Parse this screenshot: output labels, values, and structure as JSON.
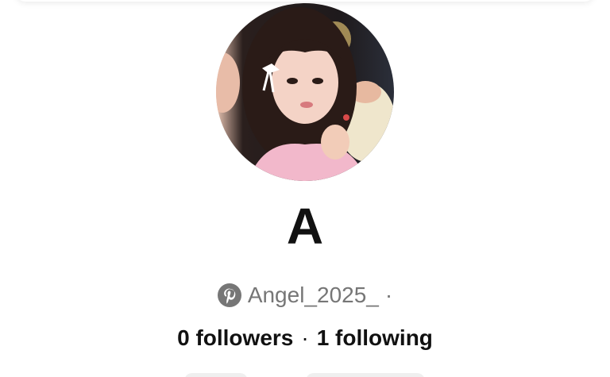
{
  "profile": {
    "display_name": "A",
    "username": "Angel_2025_",
    "username_suffix": "·",
    "followers_count": "0 followers",
    "separator": "·",
    "following_count": "1 following",
    "avatar_icon": "profile-photo",
    "platform_icon": "pinterest-icon"
  },
  "colors": {
    "text_primary": "#111111",
    "text_secondary": "#767676",
    "pinterest_grey": "#767676",
    "button_bg": "#efefef"
  }
}
